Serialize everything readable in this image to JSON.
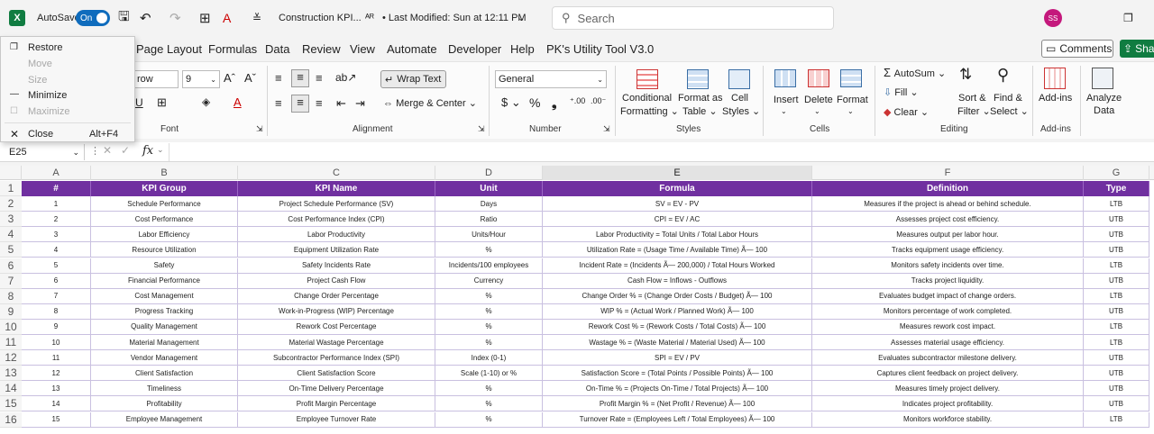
{
  "titlebar": {
    "app_icon": "X",
    "autosave_label": "AutoSave",
    "autosave_state": "On",
    "doc_title": "Construction KPI...",
    "modified": "• Last Modified: Sun at 12:11 PM",
    "search_placeholder": "Search",
    "user_initials": "SS"
  },
  "menu": {
    "items": [
      "Page Layout",
      "Formulas",
      "Data",
      "Review",
      "View",
      "Automate",
      "Developer",
      "Help",
      "PK's Utility Tool V3.0"
    ],
    "comments": "Comments",
    "share": "Shar"
  },
  "context_menu": {
    "restore": "Restore",
    "move": "Move",
    "size": "Size",
    "minimize": "Minimize",
    "maximize": "Maximize",
    "close": "Close",
    "close_shortcut": "Alt+F4"
  },
  "ribbon": {
    "font_name": "row",
    "font_size": "9",
    "font_group": "Font",
    "wrap_text": "Wrap Text",
    "merge_center": "Merge & Center",
    "alignment_group": "Alignment",
    "number_format": "General",
    "number_group": "Number",
    "conditional_1": "Conditional",
    "conditional_2": "Formatting",
    "format_as_1": "Format as",
    "format_as_2": "Table",
    "cell_styles_1": "Cell",
    "cell_styles_2": "Styles",
    "styles_group": "Styles",
    "insert": "Insert",
    "delete": "Delete",
    "format": "Format",
    "cells_group": "Cells",
    "autosum": "AutoSum",
    "fill": "Fill",
    "clear": "Clear",
    "sort_1": "Sort &",
    "sort_2": "Filter",
    "find_1": "Find &",
    "find_2": "Select",
    "editing_group": "Editing",
    "addins": "Add-ins",
    "addins_group": "Add-ins",
    "analyze_1": "Analyze",
    "analyze_2": "Data"
  },
  "formula_bar": {
    "name_box": "E25",
    "fx": "fx"
  },
  "sheet": {
    "columns": [
      "A",
      "B",
      "C",
      "D",
      "E",
      "F",
      "G"
    ],
    "headers": [
      "#",
      "KPI Group",
      "KPI Name",
      "Unit",
      "Formula",
      "Definition",
      "Type"
    ],
    "rows": [
      [
        "1",
        "Schedule Performance",
        "Project Schedule Performance (SV)",
        "Days",
        "SV = EV - PV",
        "Measures if the project is ahead or behind schedule.",
        "LTB"
      ],
      [
        "2",
        "Cost Performance",
        "Cost Performance Index (CPI)",
        "Ratio",
        "CPI = EV / AC",
        "Assesses project cost efficiency.",
        "UTB"
      ],
      [
        "3",
        "Labor Efficiency",
        "Labor Productivity",
        "Units/Hour",
        "Labor Productivity = Total Units / Total Labor Hours",
        "Measures output per labor hour.",
        "UTB"
      ],
      [
        "4",
        "Resource Utilization",
        "Equipment Utilization Rate",
        "%",
        "Utilization Rate = (Usage Time / Available Time) Ã— 100",
        "Tracks equipment usage efficiency.",
        "UTB"
      ],
      [
        "5",
        "Safety",
        "Safety Incidents Rate",
        "Incidents/100 employees",
        "Incident Rate = (Incidents Ã— 200,000) / Total Hours Worked",
        "Monitors safety incidents over time.",
        "LTB"
      ],
      [
        "6",
        "Financial Performance",
        "Project Cash Flow",
        "Currency",
        "Cash Flow = Inflows - Outflows",
        "Tracks project liquidity.",
        "UTB"
      ],
      [
        "7",
        "Cost Management",
        "Change Order Percentage",
        "%",
        "Change Order % = (Change Order Costs / Budget) Ã— 100",
        "Evaluates budget impact of change orders.",
        "LTB"
      ],
      [
        "8",
        "Progress Tracking",
        "Work-in-Progress (WIP) Percentage",
        "%",
        "WIP % = (Actual Work / Planned Work) Ã— 100",
        "Monitors percentage of work completed.",
        "UTB"
      ],
      [
        "9",
        "Quality Management",
        "Rework Cost Percentage",
        "%",
        "Rework Cost % = (Rework Costs / Total Costs) Ã— 100",
        "Measures rework cost impact.",
        "LTB"
      ],
      [
        "10",
        "Material Management",
        "Material Wastage Percentage",
        "%",
        "Wastage % = (Waste Material / Material Used) Ã— 100",
        "Assesses material usage efficiency.",
        "LTB"
      ],
      [
        "11",
        "Vendor Management",
        "Subcontractor Performance Index (SPI)",
        "Index (0-1)",
        "SPI = EV / PV",
        "Evaluates subcontractor milestone delivery.",
        "UTB"
      ],
      [
        "12",
        "Client Satisfaction",
        "Client Satisfaction Score",
        "Scale (1-10) or %",
        "Satisfaction Score = (Total Points / Possible Points) Ã— 100",
        "Captures client feedback on project delivery.",
        "UTB"
      ],
      [
        "13",
        "Timeliness",
        "On-Time Delivery Percentage",
        "%",
        "On-Time % = (Projects On-Time / Total Projects) Ã— 100",
        "Measures timely project delivery.",
        "UTB"
      ],
      [
        "14",
        "Profitability",
        "Profit Margin Percentage",
        "%",
        "Profit Margin % = (Net Profit / Revenue) Ã— 100",
        "Indicates project profitability.",
        "UTB"
      ],
      [
        "15",
        "Employee Management",
        "Employee Turnover Rate",
        "%",
        "Turnover Rate = (Employees Left / Total Employees) Ã— 100",
        "Monitors workforce stability.",
        "LTB"
      ]
    ]
  }
}
